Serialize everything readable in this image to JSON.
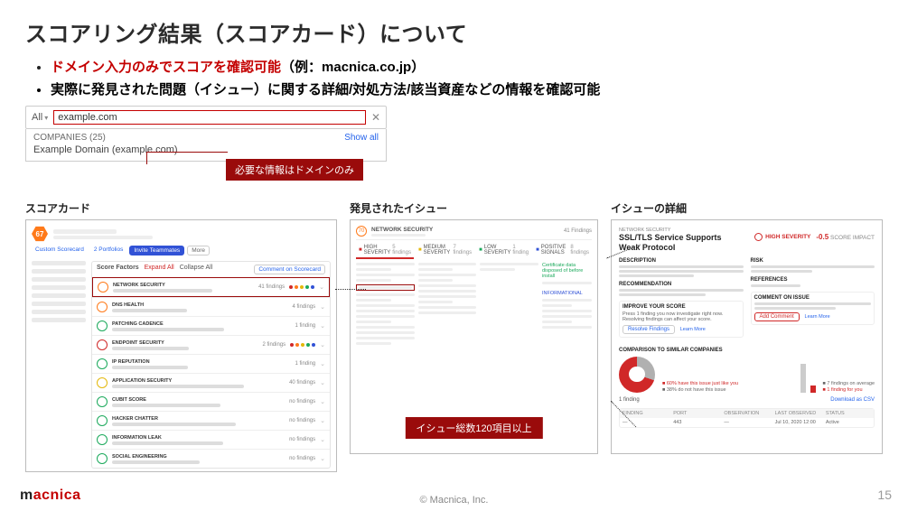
{
  "title": "スコアリング結果（スコアカード）について",
  "bullets": {
    "b1_red": "ドメイン入力のみでスコアを確認可能",
    "b1_black": "（例：macnica.co.jp）",
    "b2": "実際に発見された問題（イシュー）に関する詳細/対処方法/該当資産などの情報を確認可能"
  },
  "search": {
    "scope": "All",
    "value": "example.com",
    "close": "✕",
    "companies_label": "COMPANIES (25)",
    "show_all": "Show all",
    "result": "Example Domain (example.com)"
  },
  "callout1": "必要な情報はドメインのみ",
  "col_titles": {
    "c1": "スコアカード",
    "c2": "発見されたイシュー",
    "c3": "イシューの詳細"
  },
  "scorecard": {
    "score": "67",
    "head_links": [
      "Custom Scorecard",
      "2 Portfolios"
    ],
    "invite": "Invite Teammates",
    "more": "More",
    "list_head_left": "Score Factors",
    "list_head_expand": "Expand All",
    "list_head_collapse": "Collapse All",
    "list_head_action": "Comment on Scorecard",
    "items": [
      {
        "ring": "orange",
        "name": "NETWORK SECURITY",
        "tag": "41 findings",
        "dots": true,
        "sel": true
      },
      {
        "ring": "orange",
        "name": "DNS HEALTH",
        "tag": "4 findings"
      },
      {
        "ring": "green",
        "name": "PATCHING CADENCE",
        "tag": "1 finding"
      },
      {
        "ring": "red",
        "name": "ENDPOINT SECURITY",
        "tag": "2 findings",
        "dots": true
      },
      {
        "ring": "green",
        "name": "IP REPUTATION",
        "tag": "1 finding"
      },
      {
        "ring": "yellow",
        "name": "APPLICATION SECURITY",
        "tag": "40 findings"
      },
      {
        "ring": "green",
        "name": "CUBIT SCORE",
        "tag": "no findings"
      },
      {
        "ring": "green",
        "name": "HACKER CHATTER",
        "tag": "no findings"
      },
      {
        "ring": "green",
        "name": "INFORMATION LEAK",
        "tag": "no findings"
      },
      {
        "ring": "green",
        "name": "SOCIAL ENGINEERING",
        "tag": "no findings"
      }
    ]
  },
  "issues": {
    "head": "NETWORK SECURITY",
    "tabs": [
      {
        "label": "HIGH SEVERITY",
        "n": "5 findings",
        "cls": "sqa",
        "active": true
      },
      {
        "label": "MEDIUM SEVERITY",
        "n": "7 findings",
        "cls": "sqb"
      },
      {
        "label": "LOW SEVERITY",
        "n": "1 finding",
        "cls": "sqc"
      },
      {
        "label": "POSITIVE SIGNALS",
        "n": "8 findings",
        "cls": "sqd"
      }
    ],
    "positive_note": "Certificate data disposed of before install",
    "info_note": "INFORMATIONAL",
    "callout": "イシュー総数120項目以上"
  },
  "detail": {
    "crumb": "NETWORK SECURITY",
    "title": "SSL/TLS Service Supports Weak Protocol",
    "sev": "HIGH SEVERITY",
    "impact_val": "-0.5",
    "impact_lbl": "SCORE IMPACT",
    "sections": {
      "desc": "DESCRIPTION",
      "risk": "RISK",
      "rec": "RECOMMENDATION",
      "ref": "REFERENCES",
      "improve": "IMPROVE YOUR SCORE",
      "comment": "COMMENT ON ISSUE"
    },
    "improve_body": "Press 1 finding you now investigate right now. Resolving findings can affect your score.",
    "btn_resolve": "Resolve Findings",
    "btn_learn": "Learn More",
    "btn_add": "Add Comment",
    "compare": "COMPARISON TO SIMILAR COMPANIES",
    "pie_legend": [
      {
        "t": "60% have this issue just like you"
      },
      {
        "t": "38% do not have this issue"
      }
    ],
    "bar_legend": [
      {
        "t": "7 findings on average"
      },
      {
        "t": "1 finding for you"
      }
    ],
    "table_sum": "1 finding",
    "table_download": "Download as CSV",
    "table_cols": [
      "FINDING",
      "PORT",
      "OBSERVATION",
      "LAST OBSERVED",
      "STATUS"
    ],
    "table_row": [
      "—",
      "443",
      "—",
      "Jul 10, 2020 12:00",
      "Active"
    ]
  },
  "footer": {
    "copy": "© Macnica, Inc.",
    "page": "15",
    "brand1": "m",
    "brand2": "acnica"
  }
}
